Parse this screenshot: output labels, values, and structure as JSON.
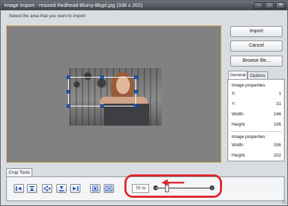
{
  "window": {
    "title": "Image Import - resized Redhead-Blurry-Bkgd.jpg  (336 x 202)",
    "minimize_glyph": "–",
    "maximize_glyph": "□",
    "close_glyph": "✕"
  },
  "instruction": "Select the area that you want to import",
  "buttons": {
    "import": "Import",
    "cancel": "Cancel",
    "browse": "Browse file..."
  },
  "tabs": [
    {
      "label": "General",
      "active": true
    },
    {
      "label": "Options",
      "active": false
    }
  ],
  "crop_properties": {
    "heading": "Image properties",
    "rows": [
      {
        "label": "X:",
        "value": "1"
      },
      {
        "label": "Y:",
        "value": "31"
      },
      {
        "label": "Width:",
        "value": "248"
      },
      {
        "label": "Height:",
        "value": "106"
      }
    ]
  },
  "image_properties": {
    "heading": "Image properties",
    "rows": [
      {
        "label": "Width:",
        "value": "336"
      },
      {
        "label": "Height:",
        "value": "202"
      }
    ]
  },
  "crop_tools": {
    "tab_label": "Crop Tools",
    "tools": [
      "align-left-icon",
      "align-top-icon",
      "center-icon",
      "align-bottom-icon",
      "align-right-icon",
      "fit-icon",
      "fill-icon"
    ]
  },
  "zoom": {
    "value_text": "70 %",
    "slider_fraction": 0.2
  },
  "colors": {
    "crop_handle": "#1b63d6",
    "highlight_ring": "#e0262b",
    "canvas_border": "#d3a64c"
  }
}
